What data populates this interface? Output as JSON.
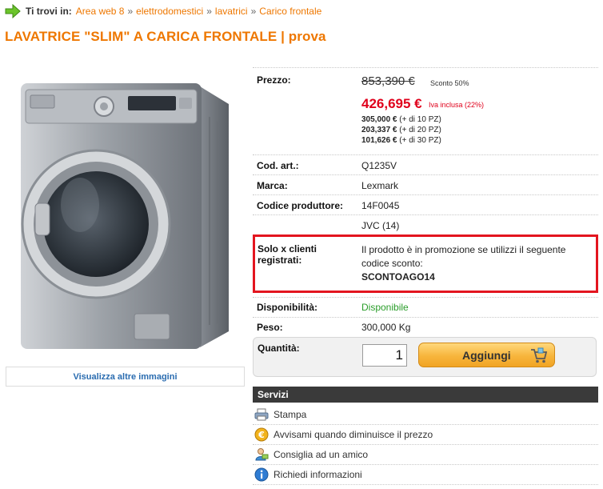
{
  "breadcrumb": {
    "prefix": "Ti trovi in:",
    "items": [
      "Area web 8",
      "elettrodomestici",
      "lavatrici",
      "Carico frontale"
    ],
    "separator": "»"
  },
  "product": {
    "title": "LAVATRICE \"SLIM\" A CARICA FRONTALE | prova",
    "more_images_label": "Visualizza altre immagini"
  },
  "price": {
    "label": "Prezzo:",
    "old": "853,390 €",
    "discount": "Sconto 50%",
    "current": "426,695 €",
    "vat_note": "Iva inclusa (22%)",
    "tiers": [
      {
        "price": "305,000 €",
        "qty": "(+ di 10 PZ)"
      },
      {
        "price": "203,337 €",
        "qty": "(+ di 20 PZ)"
      },
      {
        "price": "101,626 €",
        "qty": "(+ di 30 PZ)"
      }
    ]
  },
  "details": {
    "code_label": "Cod. art.:",
    "code_value": "Q1235V",
    "brand_label": "Marca:",
    "brand_value": "Lexmark",
    "manufacturer_code_label": "Codice produttore:",
    "manufacturer_code_value": "14F0045",
    "extra_value": "JVC (14)",
    "availability_label": "Disponibilità:",
    "availability_value": "Disponibile",
    "weight_label": "Peso:",
    "weight_value": "300,000 Kg"
  },
  "promo": {
    "label_line1": "Solo x clienti",
    "label_line2": "registrati:",
    "text": "Il prodotto è in promozione se utilizzi il seguente codice sconto:",
    "code": "SCONTOAGO14"
  },
  "purchase": {
    "quantity_label": "Quantità:",
    "quantity_value": "1",
    "add_label": "Aggiungi"
  },
  "services": {
    "header": "Servizi",
    "items": [
      {
        "label": "Stampa",
        "icon": "printer-icon"
      },
      {
        "label": "Avvisami quando diminuisce il prezzo",
        "icon": "euro-coin-icon"
      },
      {
        "label": "Consiglia ad un amico",
        "icon": "user-share-icon"
      },
      {
        "label": "Richiedi informazioni",
        "icon": "info-icon"
      }
    ]
  },
  "colors": {
    "accent_orange": "#ee7700",
    "price_red": "#e0001b",
    "promo_border": "#e3151f",
    "available_green": "#2a9d2a",
    "link_blue": "#2a6cb0"
  }
}
